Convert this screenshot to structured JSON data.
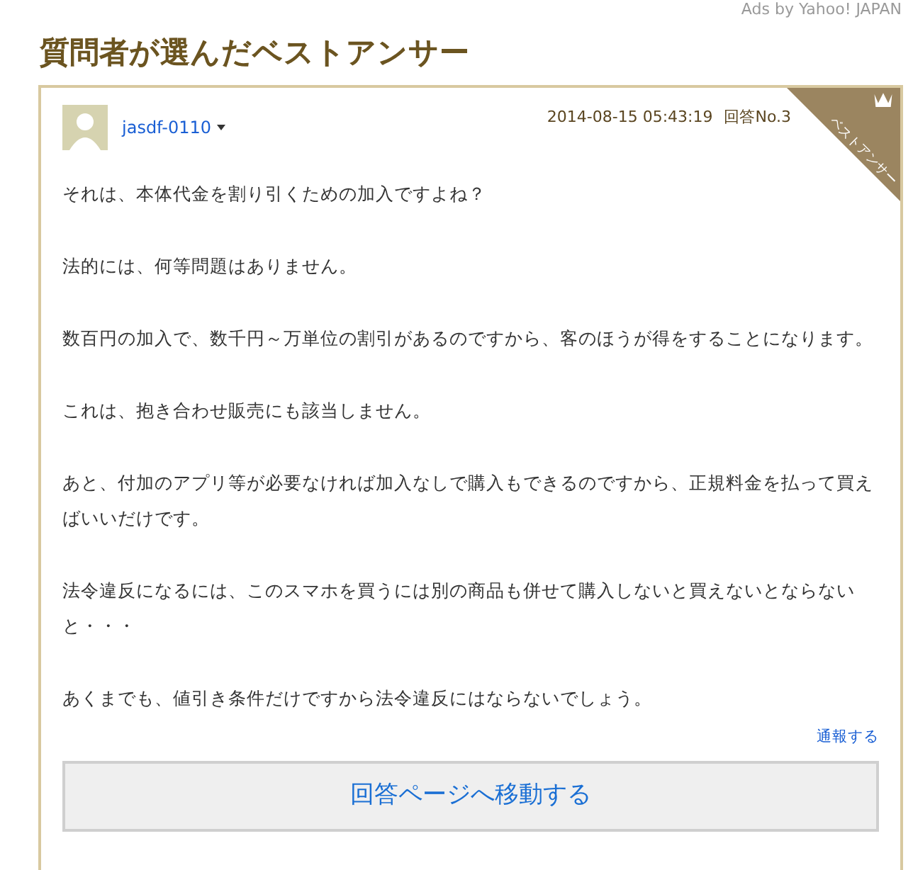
{
  "ads_label": "Ads by Yahoo! JAPAN",
  "heading": "質問者が選んだベストアンサー",
  "answer": {
    "user": "jasdf-0110",
    "datetime": "2014-08-15 05:43:19",
    "answer_no": "回答No.3",
    "ribbon": "ベストアンサー",
    "paragraphs": [
      "それは、本体代金を割り引くための加入ですよね？",
      "法的には、何等問題はありません。",
      "数百円の加入で、数千円～万単位の割引があるのですから、客のほうが得をすることになります。",
      "これは、抱き合わせ販売にも該当しません。",
      "あと、付加のアプリ等が必要なければ加入なしで購入もできるのですから、正規料金を払って買えばいいだけです。",
      "法令違反になるには、このスマホを買うには別の商品も併せて購入しないと買えないとならないと・・・",
      "あくまでも、値引き条件だけですから法令違反にはならないでしょう。"
    ],
    "report_link": "通報する"
  },
  "move_button": "回答ページへ移動する"
}
